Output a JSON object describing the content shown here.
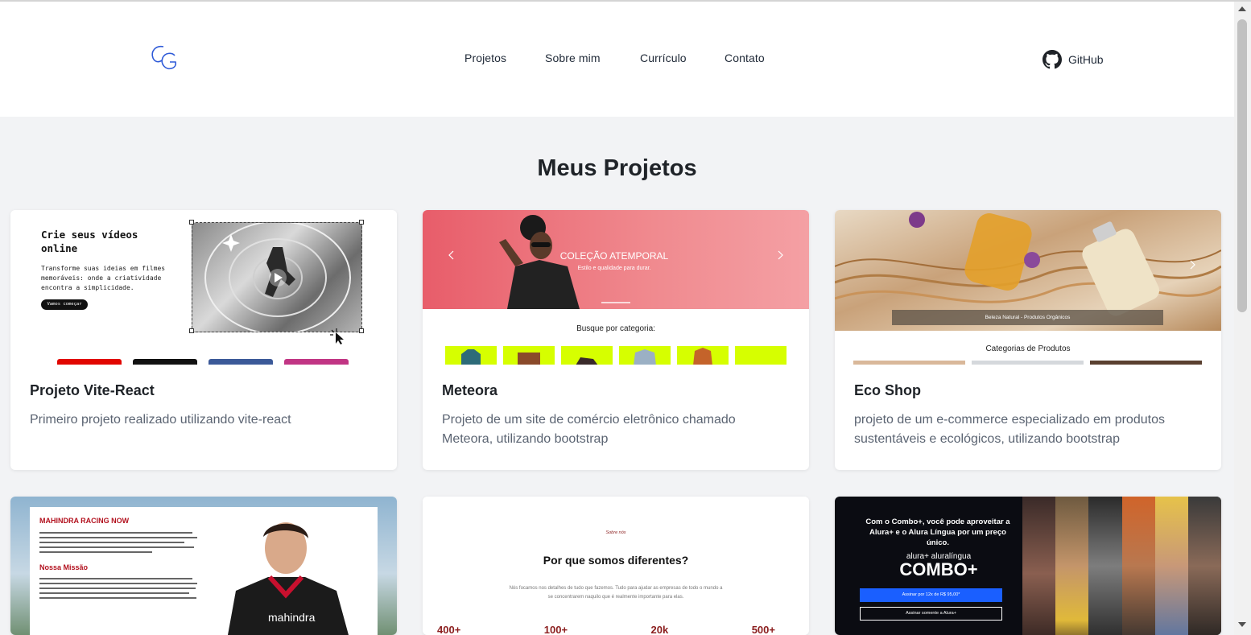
{
  "nav": {
    "logo_text": "CG",
    "items": [
      "Projetos",
      "Sobre mim",
      "Currículo",
      "Contato"
    ],
    "github_label": "GitHub"
  },
  "section_title": "Meus Projetos",
  "projects": [
    {
      "title": "Projeto Vite-React",
      "description": "Primeiro projeto realizado utilizando vite-react",
      "preview": {
        "heading": "Crie seus vídeos online",
        "subtext": "Transforme suas ideias em filmes memoráveis: onde a criatividade encontra a simplicidade.",
        "button": "Vamos começar"
      }
    },
    {
      "title": "Meteora",
      "description": "Projeto de um site de comércio eletrônico chamado Meteora, utilizando bootstrap",
      "preview": {
        "hero_title": "COLEÇÃO ATEMPORAL",
        "hero_subtitle": "Estilo e qualidade para durar.",
        "category_label": "Busque por categoria:"
      }
    },
    {
      "title": "Eco Shop",
      "description": "projeto de um e-commerce especializado em produtos sustentáveis e ecológicos, utilizando bootstrap",
      "preview": {
        "banner": "Beleza Natural - Produtos Orgânicos",
        "category_label": "Categorias de Produtos"
      }
    },
    {
      "title": "",
      "description": "",
      "preview": {
        "heading": "MAHINDRA RACING NOW",
        "section": "Nossa Missão"
      }
    },
    {
      "title": "",
      "description": "",
      "preview": {
        "eyebrow": "Sobre nós",
        "heading": "Por que somos diferentes?",
        "subtext": "Nós focamos nos detalhes de tudo que fazemos. Tudo para ajudar as empresas de todo o mundo a se concentrarem naquilo que é realmente importante para elas.",
        "stats": [
          "400+",
          "100+",
          "20k",
          "500+"
        ]
      }
    },
    {
      "title": "",
      "description": "",
      "preview": {
        "heading": "Com o Combo+, você pode aproveitar a Alura+ e o Alura Língua por um preço único.",
        "brand": "alura+ aluralíngua",
        "combo": "COMBO+",
        "cta_primary": "Assinar por 12x de R$ 95,00*",
        "cta_secondary": "Assinar somente a Alura+"
      }
    }
  ],
  "colors": {
    "background": "#f2f3f5",
    "card": "#ffffff",
    "logo": "#2f5bd8",
    "meteora_accent": "#d6ff00",
    "mahindra_red": "#b3121f"
  }
}
